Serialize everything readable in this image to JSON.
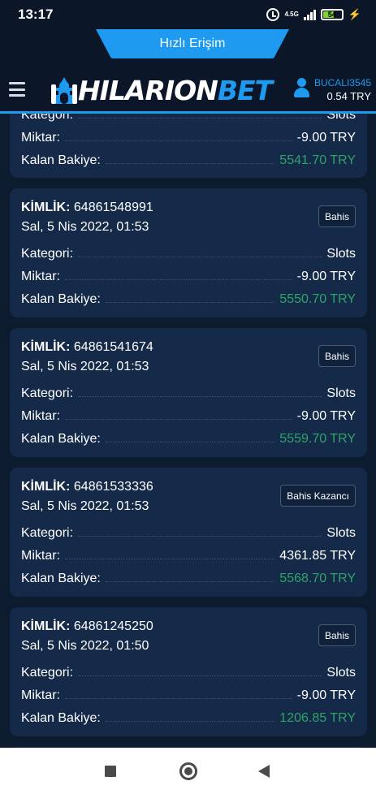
{
  "status_bar": {
    "time": "13:17",
    "network": "4.5G",
    "battery": "54"
  },
  "header": {
    "quick_access": "Hızlı Erişim",
    "logo_main": "HILARION",
    "logo_accent": "BET",
    "username": "BUCALI3545",
    "balance": "0.54 TRY"
  },
  "labels": {
    "id": "KİMLİK:",
    "category": "Kategori:",
    "amount": "Miktar:",
    "remaining": "Kalan Bakiye:"
  },
  "transactions": [
    {
      "id": "",
      "date": "",
      "badge": "",
      "category": "Slots",
      "amount": "-9.00 TRY",
      "remaining": "5541.70 TRY"
    },
    {
      "id": "64861548991",
      "date": "Sal, 5 Nis 2022, 01:53",
      "badge": "Bahis",
      "category": "Slots",
      "amount": "-9.00 TRY",
      "remaining": "5550.70 TRY"
    },
    {
      "id": "64861541674",
      "date": "Sal, 5 Nis 2022, 01:53",
      "badge": "Bahis",
      "category": "Slots",
      "amount": "-9.00 TRY",
      "remaining": "5559.70 TRY"
    },
    {
      "id": "64861533336",
      "date": "Sal, 5 Nis 2022, 01:53",
      "badge": "Bahis Kazancı",
      "category": "Slots",
      "amount": "4361.85 TRY",
      "remaining": "5568.70 TRY"
    },
    {
      "id": "64861245250",
      "date": "Sal, 5 Nis 2022, 01:50",
      "badge": "Bahis",
      "category": "Slots",
      "amount": "-9.00 TRY",
      "remaining": "1206.85 TRY"
    }
  ],
  "colors": {
    "accent": "#1e9bf0",
    "positive": "#2ea36a",
    "card": "#152a48",
    "background": "#0d1b2e"
  }
}
